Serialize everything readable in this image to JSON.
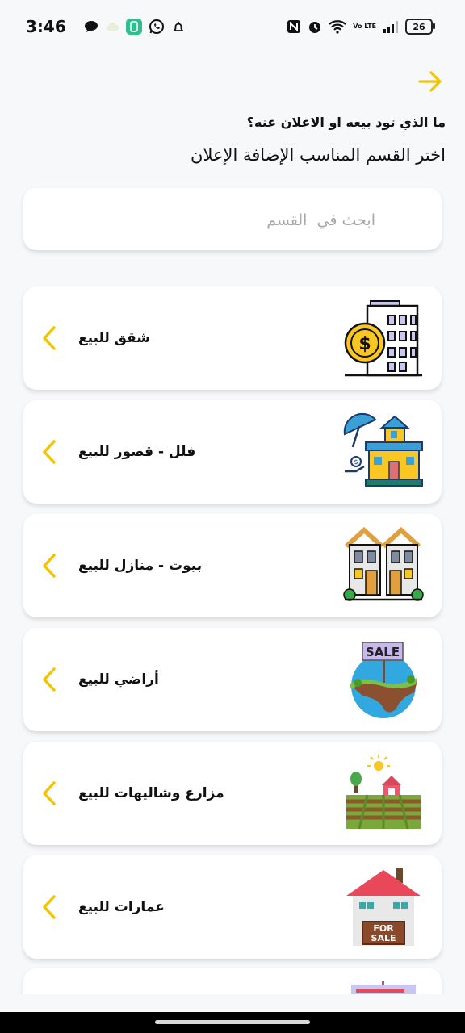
{
  "status_bar": {
    "time": "3:46",
    "battery": "26",
    "network": "Vo LTE"
  },
  "header": {
    "question": "ما الذي تود بيعه او الاعلان عنه؟",
    "subtitle": "اختر القسم المناسب الإضافة الإعلان"
  },
  "search": {
    "placeholder": "ابحث في  القسم",
    "value": ""
  },
  "colors": {
    "accent": "#F5C400",
    "background": "#F7F8FA"
  },
  "categories": [
    {
      "label": "شقق للبيع",
      "icon": "apartment-building-dollar-icon"
    },
    {
      "label": "فلل - قصور للبيع",
      "icon": "villa-umbrella-icon"
    },
    {
      "label": "بيوت - منازل للبيع",
      "icon": "twin-houses-icon"
    },
    {
      "label": "أراضي للبيع",
      "icon": "land-sale-sign-icon"
    },
    {
      "label": "مزارع وشاليهات للبيع",
      "icon": "farm-field-icon"
    },
    {
      "label": "عمارات للبيع",
      "icon": "house-for-sale-icon"
    },
    {
      "label": "",
      "icon": "office-sign-icon"
    }
  ],
  "for_sale_sign": "FOR SALE",
  "sale_sign": "SALE"
}
